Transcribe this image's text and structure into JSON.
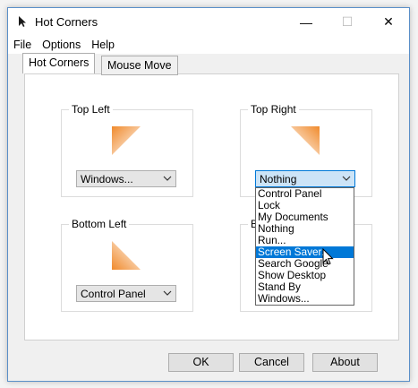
{
  "window": {
    "title": "Hot Corners",
    "controls": {
      "minimize": "—",
      "maximize": "☐",
      "close": "✕"
    }
  },
  "menu": [
    "File",
    "Options",
    "Help"
  ],
  "tabs": [
    {
      "label": "Hot Corners",
      "active": true
    },
    {
      "label": "Mouse Move",
      "active": false
    }
  ],
  "corners": {
    "top_left": {
      "label": "Top Left",
      "value": "Windows..."
    },
    "top_right": {
      "label": "Top Right",
      "value": "Nothing"
    },
    "bottom_left": {
      "label": "Bottom Left",
      "value": "Control Panel"
    },
    "bottom_right": {
      "label": "B"
    }
  },
  "dropdown": {
    "options": [
      "Control Panel",
      "Lock",
      "My Documents",
      "Nothing",
      "Run...",
      "Screen Saver...",
      "Search Google",
      "Show Desktop",
      "Stand By",
      "Windows..."
    ],
    "highlighted": "Screen Saver..."
  },
  "buttons": {
    "ok": "OK",
    "cancel": "Cancel",
    "about": "About"
  },
  "colors": {
    "accent": "#0078d7",
    "corner_orange": "#f08a2c",
    "dropdown_open": "#cce4f7"
  }
}
